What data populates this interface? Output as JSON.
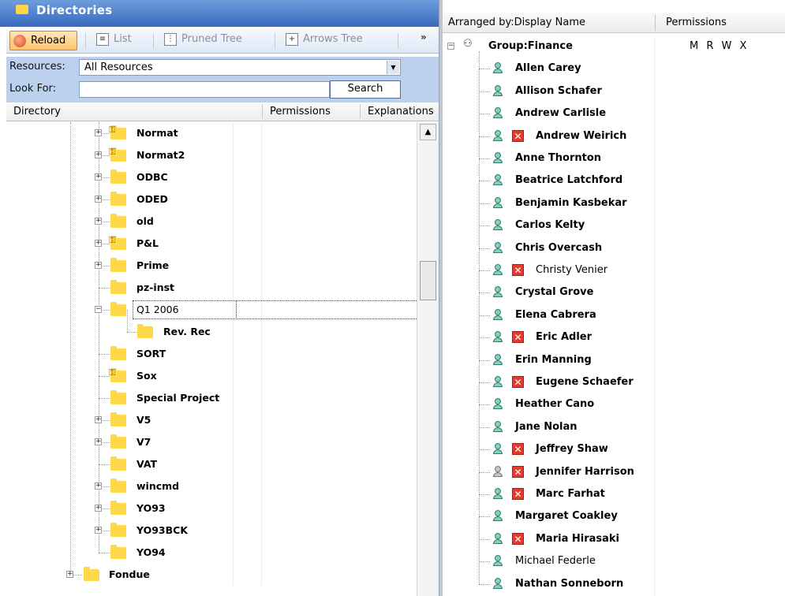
{
  "left_pane": {
    "title": "Directories",
    "toolbar": {
      "reload_label": "Reload",
      "list_label": "List",
      "pruned_tree_label": "Pruned Tree",
      "arrows_tree_label": "Arrows Tree",
      "more_label": "»"
    },
    "filters": {
      "resources_label": "Resources:",
      "resources_value": "All Resources",
      "look_for_label": "Look For:",
      "look_for_value": "",
      "search_label": "Search"
    },
    "columns": [
      "Directory",
      "Permissions",
      "Explanations"
    ],
    "tree": [
      {
        "label": "Normat",
        "secure": true,
        "expander": "+"
      },
      {
        "label": "Normat2",
        "secure": true,
        "expander": "+"
      },
      {
        "label": "ODBC",
        "secure": false,
        "expander": "+"
      },
      {
        "label": "ODED",
        "secure": false,
        "expander": "+"
      },
      {
        "label": "old",
        "secure": false,
        "expander": "+"
      },
      {
        "label": "P&L",
        "secure": true,
        "expander": "+"
      },
      {
        "label": "Prime",
        "secure": false,
        "expander": "+"
      },
      {
        "label": "pz-inst",
        "secure": false,
        "expander": ""
      },
      {
        "label": "Q1 2006",
        "secure": false,
        "expander": "-",
        "editing": true
      },
      {
        "label": "Rev. Rec",
        "secure": false,
        "expander": "",
        "child": true
      },
      {
        "label": "SORT",
        "secure": false,
        "expander": ""
      },
      {
        "label": "Sox",
        "secure": true,
        "expander": ""
      },
      {
        "label": "Special Project",
        "secure": false,
        "expander": ""
      },
      {
        "label": "V5",
        "secure": false,
        "expander": "+"
      },
      {
        "label": "V7",
        "secure": false,
        "expander": "+"
      },
      {
        "label": "VAT",
        "secure": false,
        "expander": ""
      },
      {
        "label": "wincmd",
        "secure": false,
        "expander": "+"
      },
      {
        "label": "YO93",
        "secure": false,
        "expander": "+"
      },
      {
        "label": "YO93BCK",
        "secure": false,
        "expander": "+"
      },
      {
        "label": "YO94",
        "secure": false,
        "expander": ""
      },
      {
        "label": "Fondue",
        "secure": false,
        "expander": "+",
        "root": true
      }
    ]
  },
  "right_pane": {
    "header_arranged": "Arranged by:Display Name",
    "header_permissions": "Permissions",
    "group": {
      "label": "Group:Finance",
      "permissions": "M R W X"
    },
    "members": [
      {
        "name": "Allen Carey",
        "denied": false,
        "bold": true
      },
      {
        "name": "Allison Schafer",
        "denied": false,
        "bold": true
      },
      {
        "name": "Andrew Carlisle",
        "denied": false,
        "bold": true
      },
      {
        "name": "Andrew Weirich",
        "denied": true,
        "bold": true
      },
      {
        "name": "Anne Thornton",
        "denied": false,
        "bold": true
      },
      {
        "name": "Beatrice Latchford",
        "denied": false,
        "bold": true
      },
      {
        "name": "Benjamin Kasbekar",
        "denied": false,
        "bold": true
      },
      {
        "name": "Carlos Kelty",
        "denied": false,
        "bold": true
      },
      {
        "name": "Chris Overcash",
        "denied": false,
        "bold": true
      },
      {
        "name": "Christy Venier",
        "denied": true,
        "bold": false
      },
      {
        "name": "Crystal Grove",
        "denied": false,
        "bold": true
      },
      {
        "name": "Elena Cabrera",
        "denied": false,
        "bold": true
      },
      {
        "name": "Eric Adler",
        "denied": true,
        "bold": true
      },
      {
        "name": "Erin Manning",
        "denied": false,
        "bold": true
      },
      {
        "name": "Eugene Schaefer",
        "denied": true,
        "bold": true
      },
      {
        "name": "Heather Cano",
        "denied": false,
        "bold": true
      },
      {
        "name": "Jane Nolan",
        "denied": false,
        "bold": true
      },
      {
        "name": "Jeffrey Shaw",
        "denied": true,
        "bold": true
      },
      {
        "name": "Jennifer Harrison",
        "denied": true,
        "bold": true,
        "grey_icon": true
      },
      {
        "name": "Marc Farhat",
        "denied": true,
        "bold": true
      },
      {
        "name": "Margaret Coakley",
        "denied": false,
        "bold": true
      },
      {
        "name": "Maria Hirasaki",
        "denied": true,
        "bold": true
      },
      {
        "name": "Michael Federle",
        "denied": false,
        "bold": false
      },
      {
        "name": "Nathan Sonneborn",
        "denied": false,
        "bold": true
      }
    ]
  }
}
